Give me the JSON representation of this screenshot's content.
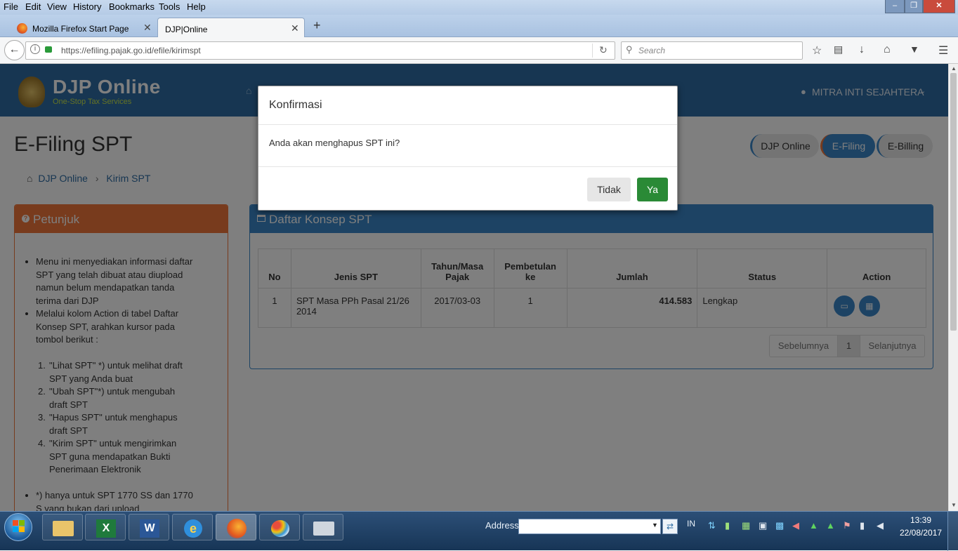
{
  "browser": {
    "menu": [
      "File",
      "Edit",
      "View",
      "History",
      "Bookmarks",
      "Tools",
      "Help"
    ],
    "tabs": [
      {
        "title": "Mozilla Firefox Start Page"
      },
      {
        "title": "DJP|Online"
      }
    ],
    "url": "https://efiling.pajak.go.id/efile/kirimspt",
    "search_placeholder": "Search"
  },
  "site": {
    "logo_title": "DJP Online",
    "logo_subtitle": "One-Stop Tax Services",
    "user_name": "MITRA INTI SEJAHTERA",
    "page_title": "E-Filing SPT",
    "nav_pills": [
      "DJP Online",
      "E-Filing",
      "E-Billing"
    ],
    "breadcrumb": [
      "DJP Online",
      "Kirim SPT"
    ]
  },
  "petunjuk": {
    "title": "Petunjuk",
    "bullets": [
      "Menu ini menyediakan informasi daftar SPT yang telah dibuat atau diupload namun belum mendapatkan tanda terima dari DJP",
      "Melalui kolom Action di tabel Daftar Konsep SPT, arahkan kursor pada tombol berikut :"
    ],
    "steps": [
      {
        "num": "1.",
        "text": "\"Lihat SPT\" *) untuk melihat draft SPT yang Anda buat"
      },
      {
        "num": "2.",
        "text": "\"Ubah SPT\"*) untuk mengubah draft SPT"
      },
      {
        "num": "3.",
        "text": "\"Hapus SPT\" untuk menghapus draft SPT"
      },
      {
        "num": "4.",
        "text": "\"Kirim SPT\" untuk mengirimkan SPT guna mendapatkan Bukti Penerimaan Elektronik"
      }
    ],
    "footnote": "*) hanya untuk SPT 1770 SS dan 1770 S yang bukan dari upload"
  },
  "daftar": {
    "title": "Daftar Konsep SPT",
    "headers": [
      "No",
      "Jenis SPT",
      "Tahun/Masa Pajak",
      "Pembetulan ke",
      "Jumlah",
      "Status",
      "Action"
    ],
    "rows": [
      {
        "no": "1",
        "jenis": "SPT Masa PPh Pasal 21/26 2014",
        "tahun": "2017/03-03",
        "pembetulan": "1",
        "jumlah": "414.583",
        "status": "Lengkap"
      }
    ],
    "pagination": {
      "prev": "Sebelumnya",
      "page": "1",
      "next": "Selanjutnya"
    }
  },
  "modal": {
    "title": "Konfirmasi",
    "message": "Anda akan menghapus SPT ini?",
    "btn_no": "Tidak",
    "btn_yes": "Ya"
  },
  "taskbar": {
    "address_label": "Address",
    "lang": "IN",
    "time": "13:39",
    "date": "22/08/2017"
  },
  "colors": {
    "header_blue": "#2e6da4",
    "panel_orange": "#f0763b",
    "panel_blue": "#3a87c8",
    "yes_green": "#2a8a36"
  }
}
